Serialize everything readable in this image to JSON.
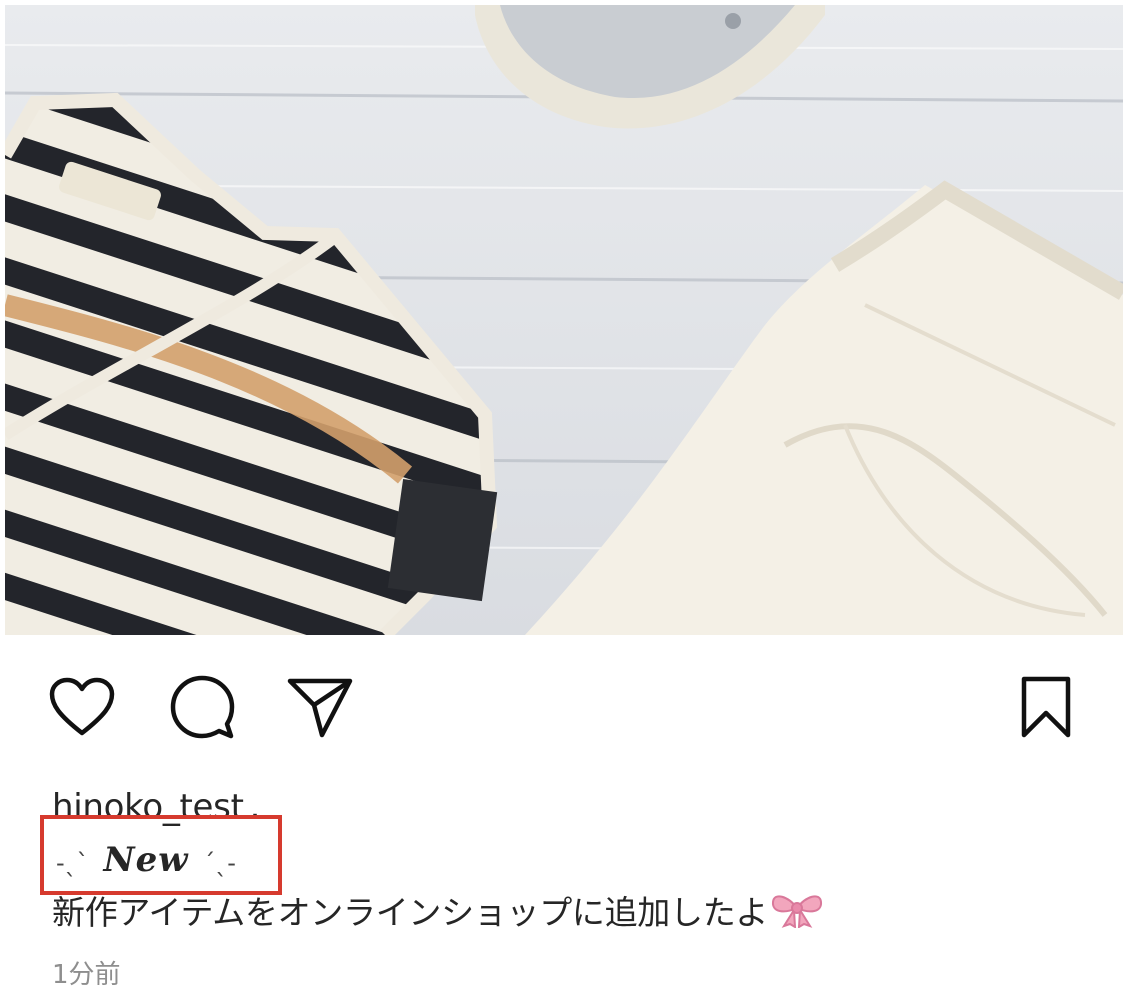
{
  "post": {
    "image_alt": "Striped top, white denim and sneaker on white wooden boards",
    "actions": {
      "like_icon": "heart-icon",
      "comment_icon": "comment-icon",
      "share_icon": "send-icon",
      "save_icon": "bookmark-icon"
    },
    "username": "hinoko_test",
    "username_separator": ".",
    "caption_deco_left": "-ˎˋ",
    "caption_new": "𝑵𝒆𝒘",
    "caption_deco_right": "ˊˎ-",
    "caption_text": "新作アイテムをオンラインショップに追加したよ",
    "caption_emoji": "ribbon",
    "timestamp": "1分前"
  },
  "colors": {
    "highlight_box": "#d63a2e",
    "timestamp": "#8e8e8e",
    "text": "#262626"
  }
}
